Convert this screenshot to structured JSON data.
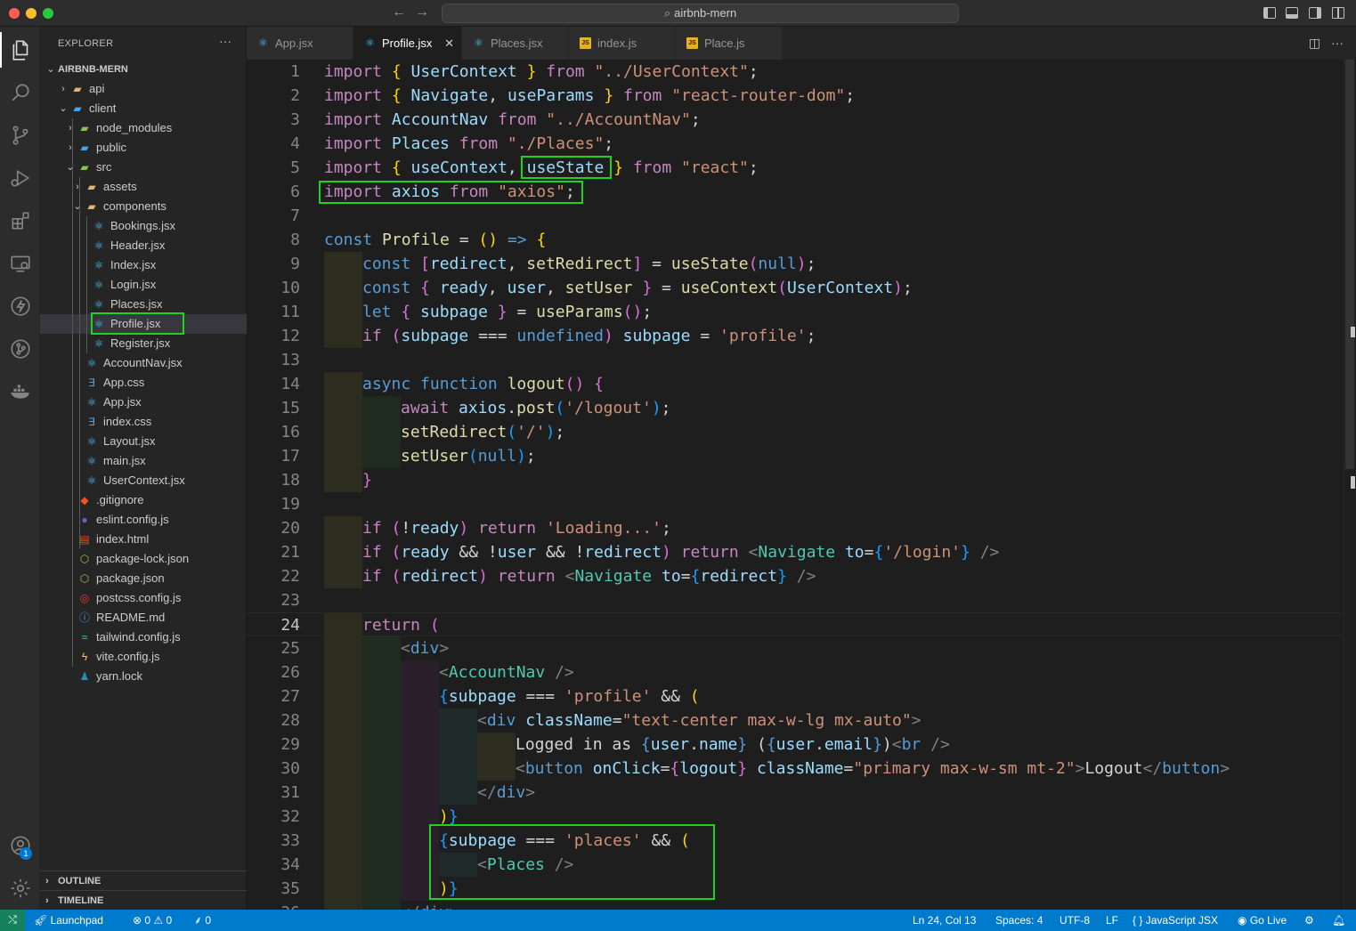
{
  "window": {
    "command_center": "airbnb-mern"
  },
  "explorer": {
    "title": "EXPLORER",
    "more": "···",
    "root": "AIRBNB-MERN",
    "tree": [
      {
        "label": "api",
        "depth": 0,
        "kind": "folder",
        "open": false,
        "icon": "folder-icon"
      },
      {
        "label": "client",
        "depth": 0,
        "kind": "folder",
        "open": true,
        "icon": "folder-client-icon"
      },
      {
        "label": "node_modules",
        "depth": 1,
        "kind": "folder",
        "open": false,
        "icon": "folder-node-icon"
      },
      {
        "label": "public",
        "depth": 1,
        "kind": "folder",
        "open": false,
        "icon": "folder-public-icon"
      },
      {
        "label": "src",
        "depth": 1,
        "kind": "folder",
        "open": true,
        "icon": "folder-src-icon"
      },
      {
        "label": "assets",
        "depth": 2,
        "kind": "folder",
        "open": false,
        "icon": "folder-icon"
      },
      {
        "label": "components",
        "depth": 2,
        "kind": "folder",
        "open": true,
        "icon": "folder-components-icon"
      },
      {
        "label": "Bookings.jsx",
        "depth": 3,
        "kind": "react"
      },
      {
        "label": "Header.jsx",
        "depth": 3,
        "kind": "react"
      },
      {
        "label": "Index.jsx",
        "depth": 3,
        "kind": "react"
      },
      {
        "label": "Login.jsx",
        "depth": 3,
        "kind": "react"
      },
      {
        "label": "Places.jsx",
        "depth": 3,
        "kind": "react"
      },
      {
        "label": "Profile.jsx",
        "depth": 3,
        "kind": "react",
        "selected": true
      },
      {
        "label": "Register.jsx",
        "depth": 3,
        "kind": "react"
      },
      {
        "label": "AccountNav.jsx",
        "depth": 2,
        "kind": "react"
      },
      {
        "label": "App.css",
        "depth": 2,
        "kind": "css"
      },
      {
        "label": "App.jsx",
        "depth": 2,
        "kind": "react"
      },
      {
        "label": "index.css",
        "depth": 2,
        "kind": "css"
      },
      {
        "label": "Layout.jsx",
        "depth": 2,
        "kind": "react"
      },
      {
        "label": "main.jsx",
        "depth": 2,
        "kind": "react"
      },
      {
        "label": "UserContext.jsx",
        "depth": 2,
        "kind": "react"
      },
      {
        "label": ".gitignore",
        "depth": 1,
        "kind": "git"
      },
      {
        "label": "eslint.config.js",
        "depth": 1,
        "kind": "eslint"
      },
      {
        "label": "index.html",
        "depth": 1,
        "kind": "html"
      },
      {
        "label": "package-lock.json",
        "depth": 1,
        "kind": "pkg"
      },
      {
        "label": "package.json",
        "depth": 1,
        "kind": "pkg"
      },
      {
        "label": "postcss.config.js",
        "depth": 1,
        "kind": "postcss"
      },
      {
        "label": "README.md",
        "depth": 1,
        "kind": "info"
      },
      {
        "label": "tailwind.config.js",
        "depth": 1,
        "kind": "tailwind"
      },
      {
        "label": "vite.config.js",
        "depth": 1,
        "kind": "vite"
      },
      {
        "label": "yarn.lock",
        "depth": 1,
        "kind": "yarn"
      }
    ],
    "outline": "OUTLINE",
    "timeline": "TIMELINE"
  },
  "tabs": [
    {
      "label": "App.jsx",
      "kind": "react",
      "active": false
    },
    {
      "label": "Profile.jsx",
      "kind": "react",
      "active": true
    },
    {
      "label": "Places.jsx",
      "kind": "react",
      "active": false
    },
    {
      "label": "index.js",
      "kind": "js",
      "active": false
    },
    {
      "label": "Place.js",
      "kind": "js",
      "active": false
    }
  ],
  "editor": {
    "current_line": 24,
    "lines": [
      [
        [
          "k",
          "import "
        ],
        [
          "br1",
          "{ "
        ],
        [
          "v",
          "UserContext "
        ],
        [
          "br1",
          "} "
        ],
        [
          "k",
          "from "
        ],
        [
          "s",
          "\"../UserContext\""
        ],
        [
          "w",
          ";"
        ]
      ],
      [
        [
          "k",
          "import "
        ],
        [
          "br1",
          "{ "
        ],
        [
          "v",
          "Navigate"
        ],
        [
          "w",
          ", "
        ],
        [
          "v",
          "useParams "
        ],
        [
          "br1",
          "} "
        ],
        [
          "k",
          "from "
        ],
        [
          "s",
          "\"react-router-dom\""
        ],
        [
          "w",
          ";"
        ]
      ],
      [
        [
          "k",
          "import "
        ],
        [
          "v",
          "AccountNav "
        ],
        [
          "k",
          "from "
        ],
        [
          "s",
          "\"../AccountNav\""
        ],
        [
          "w",
          ";"
        ]
      ],
      [
        [
          "k",
          "import "
        ],
        [
          "v",
          "Places "
        ],
        [
          "k",
          "from "
        ],
        [
          "s",
          "\"./Places\""
        ],
        [
          "w",
          ";"
        ]
      ],
      [
        [
          "k",
          "import "
        ],
        [
          "br1",
          "{ "
        ],
        [
          "v",
          "useContext"
        ],
        [
          "w",
          ", "
        ],
        [
          "v",
          "useState "
        ],
        [
          "br1",
          "} "
        ],
        [
          "k",
          "from "
        ],
        [
          "s",
          "\"react\""
        ],
        [
          "w",
          ";"
        ]
      ],
      [
        [
          "k",
          "import "
        ],
        [
          "v",
          "axios "
        ],
        [
          "k",
          "from "
        ],
        [
          "s",
          "\"axios\""
        ],
        [
          "w",
          ";"
        ]
      ],
      [],
      [
        [
          "b",
          "const "
        ],
        [
          "f",
          "Profile "
        ],
        [
          "w",
          "= "
        ],
        [
          "br1",
          "() "
        ],
        [
          "b",
          "=> "
        ],
        [
          "br1",
          "{"
        ]
      ],
      [
        [
          "b",
          "const "
        ],
        [
          "br2",
          "["
        ],
        [
          "v",
          "redirect"
        ],
        [
          "w",
          ", "
        ],
        [
          "f",
          "setRedirect"
        ],
        [
          "br2",
          "] "
        ],
        [
          "w",
          "= "
        ],
        [
          "f",
          "useState"
        ],
        [
          "br2",
          "("
        ],
        [
          "b",
          "null"
        ],
        [
          "br2",
          ")"
        ],
        [
          "w",
          ";"
        ]
      ],
      [
        [
          "b",
          "const "
        ],
        [
          "br2",
          "{ "
        ],
        [
          "v",
          "ready"
        ],
        [
          "w",
          ", "
        ],
        [
          "v",
          "user"
        ],
        [
          "w",
          ", "
        ],
        [
          "f",
          "setUser "
        ],
        [
          "br2",
          "} "
        ],
        [
          "w",
          "= "
        ],
        [
          "f",
          "useContext"
        ],
        [
          "br2",
          "("
        ],
        [
          "v",
          "UserContext"
        ],
        [
          "br2",
          ")"
        ],
        [
          "w",
          ";"
        ]
      ],
      [
        [
          "b",
          "let "
        ],
        [
          "br2",
          "{ "
        ],
        [
          "v",
          "subpage "
        ],
        [
          "br2",
          "} "
        ],
        [
          "w",
          "= "
        ],
        [
          "f",
          "useParams"
        ],
        [
          "br2",
          "()"
        ],
        [
          "w",
          ";"
        ]
      ],
      [
        [
          "k",
          "if "
        ],
        [
          "br2",
          "("
        ],
        [
          "v",
          "subpage "
        ],
        [
          "w",
          "=== "
        ],
        [
          "b",
          "undefined"
        ],
        [
          "br2",
          ") "
        ],
        [
          "v",
          "subpage "
        ],
        [
          "w",
          "= "
        ],
        [
          "s",
          "'profile'"
        ],
        [
          "w",
          ";"
        ]
      ],
      [],
      [
        [
          "b",
          "async "
        ],
        [
          "b",
          "function "
        ],
        [
          "f",
          "logout"
        ],
        [
          "br2",
          "() {"
        ]
      ],
      [
        [
          "k",
          "await "
        ],
        [
          "v",
          "axios"
        ],
        [
          "w",
          "."
        ],
        [
          "f",
          "post"
        ],
        [
          "br3",
          "("
        ],
        [
          "s",
          "'/logout'"
        ],
        [
          "br3",
          ")"
        ],
        [
          "w",
          ";"
        ]
      ],
      [
        [
          "f",
          "setRedirect"
        ],
        [
          "br3",
          "("
        ],
        [
          "s",
          "'/'"
        ],
        [
          "br3",
          ")"
        ],
        [
          "w",
          ";"
        ]
      ],
      [
        [
          "f",
          "setUser"
        ],
        [
          "br3",
          "("
        ],
        [
          "b",
          "null"
        ],
        [
          "br3",
          ")"
        ],
        [
          "w",
          ";"
        ]
      ],
      [
        [
          "br2",
          "}"
        ]
      ],
      [],
      [
        [
          "k",
          "if "
        ],
        [
          "br2",
          "("
        ],
        [
          "w",
          "!"
        ],
        [
          "v",
          "ready"
        ],
        [
          "br2",
          ") "
        ],
        [
          "k",
          "return "
        ],
        [
          "s",
          "'Loading...'"
        ],
        [
          "w",
          ";"
        ]
      ],
      [
        [
          "k",
          "if "
        ],
        [
          "br2",
          "("
        ],
        [
          "v",
          "ready "
        ],
        [
          "w",
          "&& !"
        ],
        [
          "v",
          "user "
        ],
        [
          "w",
          "&& !"
        ],
        [
          "v",
          "redirect"
        ],
        [
          "br2",
          ") "
        ],
        [
          "k",
          "return "
        ],
        [
          "g",
          "<"
        ],
        [
          "t",
          "Navigate "
        ],
        [
          "v",
          "to"
        ],
        [
          "w",
          "="
        ],
        [
          "br3",
          "{"
        ],
        [
          "s",
          "'/login'"
        ],
        [
          "br3",
          "} "
        ],
        [
          "g",
          "/>"
        ]
      ],
      [
        [
          "k",
          "if "
        ],
        [
          "br2",
          "("
        ],
        [
          "v",
          "redirect"
        ],
        [
          "br2",
          ") "
        ],
        [
          "k",
          "return "
        ],
        [
          "g",
          "<"
        ],
        [
          "t",
          "Navigate "
        ],
        [
          "v",
          "to"
        ],
        [
          "w",
          "="
        ],
        [
          "br3",
          "{"
        ],
        [
          "v",
          "redirect"
        ],
        [
          "br3",
          "} "
        ],
        [
          "g",
          "/>"
        ]
      ],
      [],
      [
        [
          "k",
          "return "
        ],
        [
          "br2",
          "("
        ]
      ],
      [
        [
          "g",
          "<"
        ],
        [
          "b",
          "div"
        ],
        [
          "g",
          ">"
        ]
      ],
      [
        [
          "g",
          "<"
        ],
        [
          "t",
          "AccountNav "
        ],
        [
          "g",
          "/>"
        ]
      ],
      [
        [
          "br3",
          "{"
        ],
        [
          "v",
          "subpage "
        ],
        [
          "w",
          "=== "
        ],
        [
          "s",
          "'profile' "
        ],
        [
          "w",
          "&& "
        ],
        [
          "br1",
          "("
        ]
      ],
      [
        [
          "g",
          "<"
        ],
        [
          "b",
          "div "
        ],
        [
          "v",
          "className"
        ],
        [
          "w",
          "="
        ],
        [
          "s",
          "\"text-center max-w-lg mx-auto\""
        ],
        [
          "g",
          ">"
        ]
      ],
      [
        [
          "w",
          "Logged in as "
        ],
        [
          "b",
          "{"
        ],
        [
          "v",
          "user"
        ],
        [
          "w",
          "."
        ],
        [
          "v",
          "name"
        ],
        [
          "b",
          "} "
        ],
        [
          "w",
          "("
        ],
        [
          "b",
          "{"
        ],
        [
          "v",
          "user"
        ],
        [
          "w",
          "."
        ],
        [
          "v",
          "email"
        ],
        [
          "b",
          "}"
        ],
        [
          "w",
          ")"
        ],
        [
          "g",
          "<"
        ],
        [
          "b",
          "br "
        ],
        [
          "g",
          "/>"
        ]
      ],
      [
        [
          "g",
          "<"
        ],
        [
          "b",
          "button "
        ],
        [
          "v",
          "onClick"
        ],
        [
          "w",
          "="
        ],
        [
          "br2",
          "{"
        ],
        [
          "v",
          "logout"
        ],
        [
          "br2",
          "} "
        ],
        [
          "v",
          "className"
        ],
        [
          "w",
          "="
        ],
        [
          "s",
          "\"primary max-w-sm mt-2\""
        ],
        [
          "g",
          ">"
        ],
        [
          "w",
          "Logout"
        ],
        [
          "g",
          "</"
        ],
        [
          "b",
          "button"
        ],
        [
          "g",
          ">"
        ]
      ],
      [
        [
          "g",
          "</"
        ],
        [
          "b",
          "div"
        ],
        [
          "g",
          ">"
        ]
      ],
      [
        [
          "br1",
          ")"
        ],
        [
          "br3",
          "}"
        ]
      ],
      [
        [
          "br3",
          "{"
        ],
        [
          "v",
          "subpage "
        ],
        [
          "w",
          "=== "
        ],
        [
          "s",
          "'places' "
        ],
        [
          "w",
          "&& "
        ],
        [
          "br1",
          "("
        ]
      ],
      [
        [
          "g",
          "<"
        ],
        [
          "t",
          "Places "
        ],
        [
          "g",
          "/>"
        ]
      ],
      [
        [
          "br1",
          ")"
        ],
        [
          "br3",
          "}"
        ]
      ],
      [
        [
          "g",
          "</"
        ],
        [
          "b",
          "div"
        ],
        [
          "g",
          ">"
        ]
      ]
    ]
  },
  "statusbar": {
    "launchpad": "Launchpad",
    "errors": "0",
    "warnings": "0",
    "ports": "0",
    "position": "Ln 24, Col 13",
    "spaces": "Spaces: 4",
    "encoding": "UTF-8",
    "eol": "LF",
    "language": "JavaScript JSX",
    "golive": "Go Live"
  },
  "account_badge": "1"
}
